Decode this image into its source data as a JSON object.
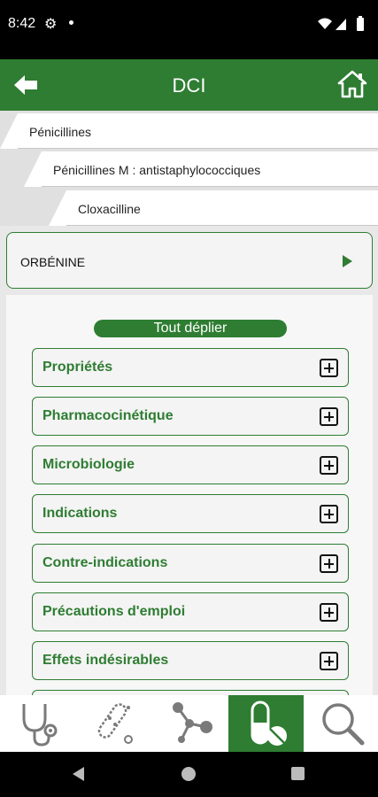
{
  "status_bar": {
    "time": "8:42"
  },
  "app_bar": {
    "title": "DCI"
  },
  "breadcrumbs": [
    "Pénicillines",
    "Pénicillines M : antistaphylococciques",
    "Cloxacilline"
  ],
  "product": {
    "name": "ORBÉNINE"
  },
  "expand_all_label": "Tout déplier",
  "sections": [
    "Propriétés",
    "Pharmacocinétique",
    "Microbiologie",
    "Indications",
    "Contre-indications",
    "Précautions d'emploi",
    "Effets indésirables"
  ],
  "bottom_nav": {
    "items": [
      "stethoscope-icon",
      "bacteria-icon",
      "molecule-icon",
      "pill-icon",
      "search-icon"
    ],
    "active": "pill-icon"
  },
  "colors": {
    "brand_green": "#2e7d32"
  }
}
